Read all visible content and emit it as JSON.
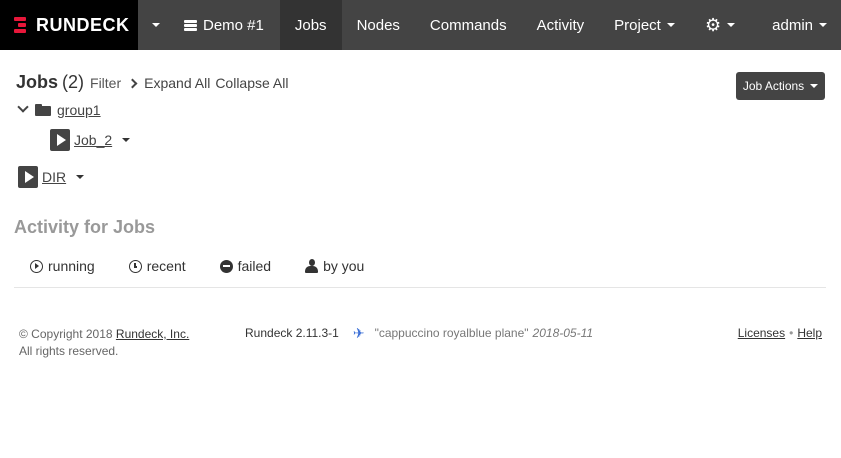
{
  "navbar": {
    "brand": "RUNDECK",
    "project_name": "Demo #1",
    "items": [
      {
        "label": "Jobs",
        "active": true
      },
      {
        "label": "Nodes"
      },
      {
        "label": "Commands"
      },
      {
        "label": "Activity"
      },
      {
        "label": "Project"
      }
    ],
    "user": "admin",
    "brand_color": "#e8173a"
  },
  "header": {
    "title": "Jobs",
    "count": "(2)",
    "filter": "Filter",
    "expand_all": "Expand All",
    "collapse_all": "Collapse All",
    "job_actions": "Job Actions"
  },
  "tree": {
    "group": "group1",
    "group_jobs": [
      {
        "name": "Job_2"
      }
    ],
    "root_jobs": [
      {
        "name": "DIR"
      }
    ]
  },
  "activity": {
    "title": "Activity for Jobs",
    "tabs": [
      "running",
      "recent",
      "failed",
      "by you"
    ]
  },
  "footer": {
    "copyright_prefix": "© Copyright 2018",
    "company": "Rundeck, Inc.",
    "rights": "All rights reserved.",
    "version": "Rundeck 2.11.3-1",
    "codename": "\"cappuccino royalblue plane\"",
    "date": "2018-05-11",
    "licenses": "Licenses",
    "separator": "•",
    "help": "Help"
  }
}
